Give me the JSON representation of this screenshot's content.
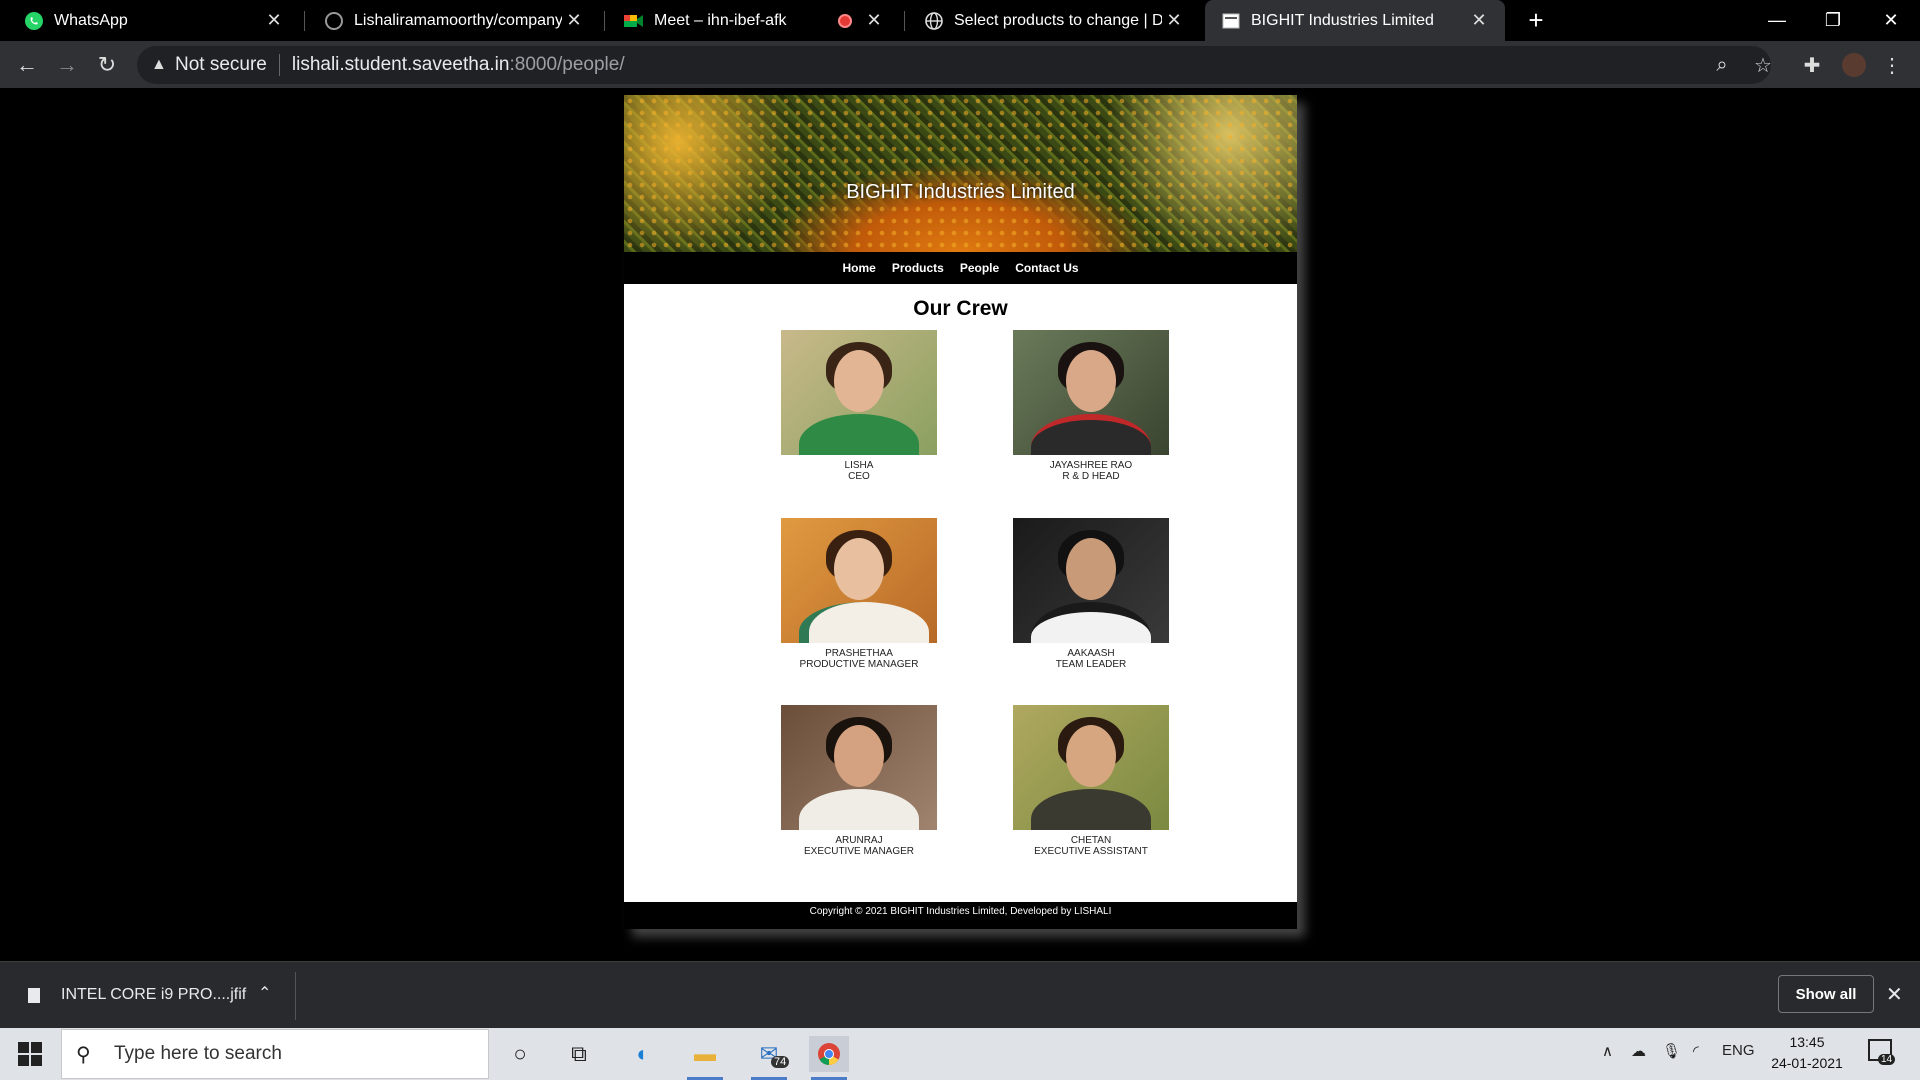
{
  "browser": {
    "tabs": [
      {
        "title": "WhatsApp",
        "icon": "whatsapp-icon",
        "active": false
      },
      {
        "title": "Lishaliramamoorthy/companywe",
        "icon": "github-icon",
        "active": false
      },
      {
        "title": "Meet – ihn-ibef-afk",
        "icon": "meet-icon",
        "active": false
      },
      {
        "title": "Select products to change | Djan",
        "icon": "globe-icon",
        "active": false
      },
      {
        "title": "BIGHIT Industries Limited",
        "icon": "page-icon",
        "active": true
      }
    ],
    "security_label": "Not secure",
    "url_host": "lishali.student.saveetha.in",
    "url_path": ":8000/people/"
  },
  "site": {
    "banner_title": "BIGHIT Industries Limited",
    "nav": [
      "Home",
      "Products",
      "People",
      "Contact Us"
    ],
    "heading": "Our Crew",
    "members": [
      {
        "name": "LISHA",
        "role": "CEO"
      },
      {
        "name": "JAYASHREE RAO",
        "role": "R & D HEAD"
      },
      {
        "name": "PRASHETHAA",
        "role": "PRODUCTIVE MANAGER"
      },
      {
        "name": "AAKAASH",
        "role": "TEAM LEADER"
      },
      {
        "name": "ARUNRAJ",
        "role": "EXECUTIVE MANAGER"
      },
      {
        "name": "CHETAN",
        "role": "EXECUTIVE ASSISTANT"
      }
    ],
    "footer": "Copyright © 2021 BIGHIT Industries Limited, Developed by LISHALI"
  },
  "downloads": {
    "file": "INTEL CORE i9 PRO....jfif",
    "show_all": "Show all"
  },
  "taskbar": {
    "search_placeholder": "Type here to search",
    "mail_badge": "74",
    "language": "ENG",
    "time": "13:45",
    "date": "24-01-2021",
    "notification_count": "14"
  },
  "colors": {
    "chrome_dark": "#303134",
    "page_bg": "#000000",
    "nav_bg": "#000000",
    "content_bg": "#ffffff",
    "taskbar_bg": "#dfe3e8"
  }
}
